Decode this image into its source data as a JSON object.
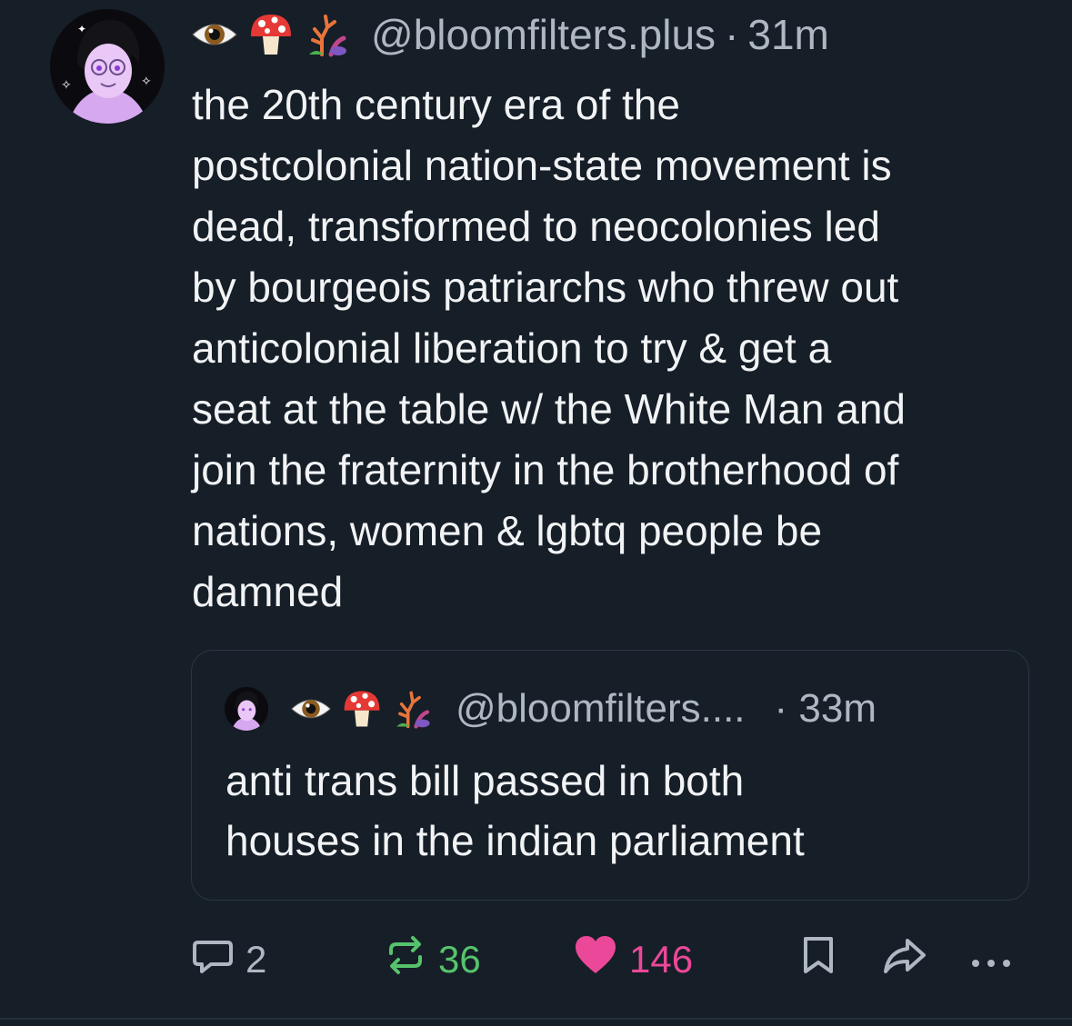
{
  "post": {
    "handle": "@bloomfilters.plus",
    "separator": "·",
    "time": "31m",
    "text": "the 20th century era of the\npostcolonial nation-state movement is\ndead, transformed to neocolonies led\nby bourgeois patriarchs who threw out\nanticolonial liberation to try & get a\nseat at the table w/ the White Man and\njoin the fraternity in the brotherhood of\nnations, women & lgbtq people be\ndamned",
    "display_emojis": [
      "eye-emoji",
      "mushroom-emoji",
      "coral-emoji"
    ]
  },
  "quote": {
    "handle": "@bloomfilters....",
    "time": "· 33m",
    "text": "anti trans bill passed in both\nhouses in the indian parliament"
  },
  "actions": {
    "reply_count": "2",
    "repost_count": "36",
    "like_count": "146"
  },
  "colors": {
    "background": "#161e27",
    "muted_text": "#aeb7c2",
    "repost_green": "#56c36c",
    "like_pink": "#ec4899",
    "avatar_purple": "#d6a8f0"
  }
}
